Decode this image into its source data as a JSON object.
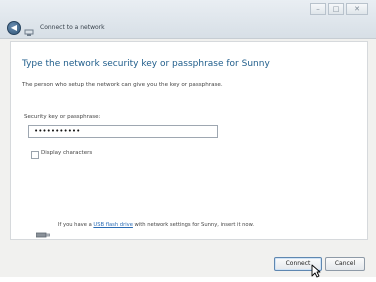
{
  "window": {
    "title": "Connect to a network",
    "controls": [
      "–",
      "□",
      "✕"
    ]
  },
  "main": {
    "heading": "Type the network security key or passphrase for Sunny",
    "description": "The person who setup the network can give you the key or passphrase.",
    "key_label": "Security key or passphrase:",
    "key_value": "•••••••••••",
    "display_label": "Display characters",
    "display_checked": false,
    "usb_prefix": "If you have a ",
    "usb_link": "USB flash drive",
    "usb_suffix": " with network settings for Sunny, insert it now."
  },
  "buttons": {
    "connect": "Connect",
    "cancel": "Cancel"
  },
  "icons": {
    "back": "back-arrow-icon",
    "network": "network-icon",
    "usb": "usb-drive-icon",
    "cursor": "mouse-pointer-icon"
  },
  "colors": {
    "accent": "#1f5d8b",
    "link": "#2b6cb5"
  }
}
